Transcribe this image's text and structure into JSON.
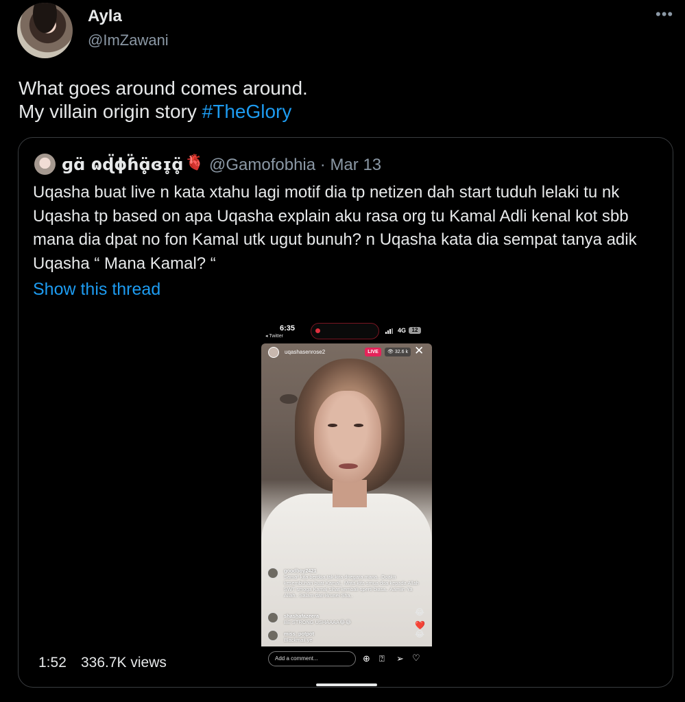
{
  "tweet": {
    "author_name": "Ayla",
    "author_handle": "@ImZawani",
    "more_glyph": "•••",
    "text_line1": "What goes around comes around.",
    "text_line2_prefix": "My villain origin story ",
    "hashtag": "#TheGlory"
  },
  "quote": {
    "author_name": "ɡɑ̈ ɷɖ̈ɸɦ̈ɑ̥̥̈ɞɪ̥ɑ̥̈",
    "author_emoji": "🫀",
    "handle_date": "@Gamofobhia · Mar 13",
    "text": "Uqasha buat live n kata xtahu lagi motif dia tp netizen dah start tuduh lelaki tu nk Uqasha tp based on apa Uqasha explain aku rasa org tu Kamal Adli kenal kot sbb mana dia dpat no fon Kamal utk ugut bunuh? n Uqasha kata dia sempat tanya adik Uqasha “ Mana Kamal? “",
    "show_thread": "Show this thread"
  },
  "video": {
    "duration": "1:52",
    "views": "336.7K views",
    "phone": {
      "time": "6:35",
      "back_label": "◂ Twitter",
      "network": "4G",
      "battery": "12",
      "live_username": "uqashasenrose2",
      "live_badge": "LIVE",
      "viewer_count": "👁 32.6 k",
      "close_glyph": "✕",
      "comments": [
        {
          "user": "goodboy2421",
          "text": "Sama² kita berdoa tak kira dnegara mana.. Doakn kesembuhan buat Kamal.. Mnta kita smua doa kepada Allah SWT smoga Kamal sihat kembali sperti biasa.. Aamiin Ya Allah.. Salam dari Brunei Sha.."
        },
        {
          "user": "shashafazeera",
          "text": "BE STRONG USHAAAA😂😂"
        },
        {
          "user": "miss_potpot",
          "text": "Blackmail ye"
        }
      ],
      "comment_placeholder": "Add a comment...",
      "side_emojis": [
        "😂",
        "❤️",
        "😂"
      ],
      "icons": {
        "add": "⊕",
        "question": "⍰",
        "share": "➢",
        "heart": "♡"
      }
    }
  }
}
